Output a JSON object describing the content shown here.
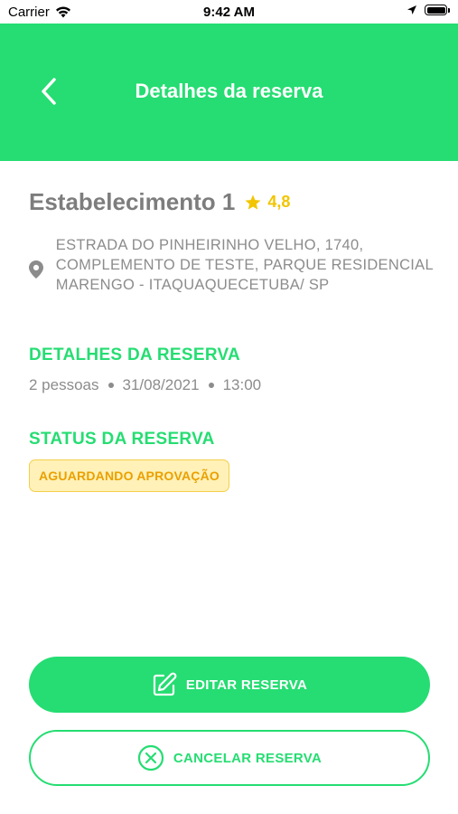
{
  "status_bar": {
    "carrier": "Carrier",
    "time": "9:42 AM"
  },
  "header": {
    "title": "Detalhes da reserva",
    "back_icon": "chevron-left-icon"
  },
  "establishment": {
    "name": "Estabelecimento 1",
    "rating": "4,8",
    "address": "ESTRADA DO PINHEIRINHO VELHO, 1740, COMPLEMENTO DE TESTE, PARQUE RESIDENCIAL MARENGO - ITAQUAQUECETUBA/ SP"
  },
  "reservation_details": {
    "title": "DETALHES DA RESERVA",
    "people": "2 pessoas",
    "date": "31/08/2021",
    "time": "13:00"
  },
  "reservation_status": {
    "title": "STATUS DA RESERVA",
    "badge": "AGUARDANDO APROVAÇÃO"
  },
  "actions": {
    "edit_label": "EDITAR RESERVA",
    "cancel_label": "CANCELAR RESERVA"
  },
  "colors": {
    "primary": "#25dd72",
    "badge_bg": "#fff1b8",
    "badge_text": "#eaa000",
    "star": "#f2c500",
    "text_gray": "#8c8c8c"
  }
}
